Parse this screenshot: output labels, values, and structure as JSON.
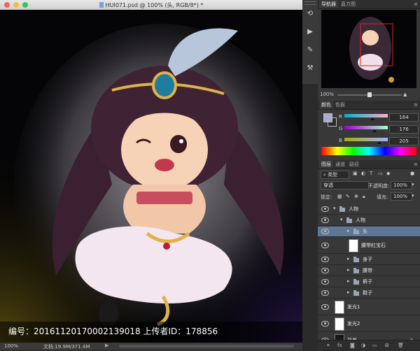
{
  "window": {
    "title": "HUI071.psd @ 100% (头, RGB/8*) *"
  },
  "canvas": {
    "caption": "编号：20161120170002139018 上传者ID：178856"
  },
  "status": {
    "zoom": "100%",
    "doc_size": "文档:19.9M/371.4M",
    "arrow": "▶"
  },
  "navigator": {
    "tabs": [
      "导航器",
      "直方图"
    ],
    "zoom": "100%",
    "zoom_level": 0.5
  },
  "color_panel": {
    "tabs": [
      "颜色",
      "色板"
    ],
    "foreground_color": "#a4b0cd",
    "background_color": "#2a2a2a",
    "channels": [
      {
        "label": "R",
        "value": "164",
        "fill": 0.64
      },
      {
        "label": "G",
        "value": "176",
        "fill": 0.69
      },
      {
        "label": "B",
        "value": "205",
        "fill": 0.8
      }
    ]
  },
  "layers_panel": {
    "tabs": [
      "图层",
      "通道",
      "路径"
    ],
    "filter_label": "类型",
    "blend_mode": "穿透",
    "opacity_label": "不透明度:",
    "opacity_value": "100%",
    "lock_label": "锁定:",
    "fill_label": "填充:",
    "fill_value": "100%",
    "layers": [
      {
        "name": "人物",
        "kind": "group",
        "indent": 0,
        "expanded": true,
        "selected": false
      },
      {
        "name": "人物",
        "kind": "group",
        "indent": 1,
        "expanded": true,
        "selected": false
      },
      {
        "name": "头",
        "kind": "group",
        "indent": 2,
        "expanded": false,
        "selected": true
      },
      {
        "name": "腰带红宝石",
        "kind": "layer",
        "indent": 2,
        "selected": false
      },
      {
        "name": "身子",
        "kind": "group",
        "indent": 2,
        "expanded": false,
        "selected": false
      },
      {
        "name": "腰带",
        "kind": "group",
        "indent": 2,
        "expanded": false,
        "selected": false
      },
      {
        "name": "裤子",
        "kind": "group",
        "indent": 2,
        "expanded": false,
        "selected": false
      },
      {
        "name": "鞋子",
        "kind": "group",
        "indent": 2,
        "expanded": false,
        "selected": false
      },
      {
        "name": "发光1",
        "kind": "layer",
        "indent": 0,
        "selected": false
      },
      {
        "name": "发光2",
        "kind": "layer",
        "indent": 0,
        "selected": false
      },
      {
        "name": "背景",
        "kind": "background",
        "indent": 0,
        "selected": false
      }
    ],
    "bottom_icons": [
      "link-icon",
      "fx-icon",
      "mask-icon",
      "adjustment-icon",
      "folder-icon",
      "new-layer-icon",
      "trash-icon"
    ]
  },
  "toolstrip": {
    "icons": [
      "history-icon",
      "actions-icon",
      "brush-presets-icon",
      "tool-presets-icon"
    ]
  }
}
